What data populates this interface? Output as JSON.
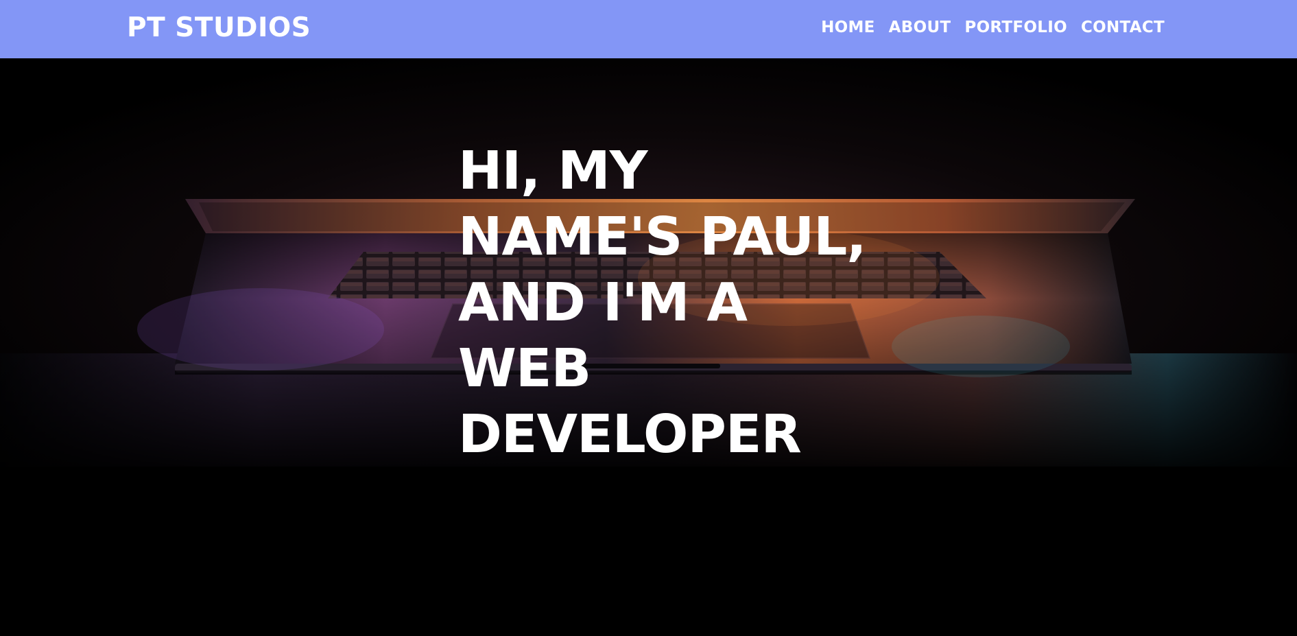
{
  "header": {
    "brand": "PT STUDIOS",
    "nav": [
      {
        "label": "HOME"
      },
      {
        "label": "ABOUT"
      },
      {
        "label": "PORTFOLIO"
      },
      {
        "label": "CONTACT"
      }
    ]
  },
  "hero": {
    "heading_lines": [
      "HI, MY",
      "NAME'S PAUL,",
      "AND I'M A",
      "WEB",
      "DEVELOPER"
    ]
  },
  "colors": {
    "navbar_bg": "#8396f6",
    "page_bg": "#000000",
    "text": "#ffffff"
  }
}
